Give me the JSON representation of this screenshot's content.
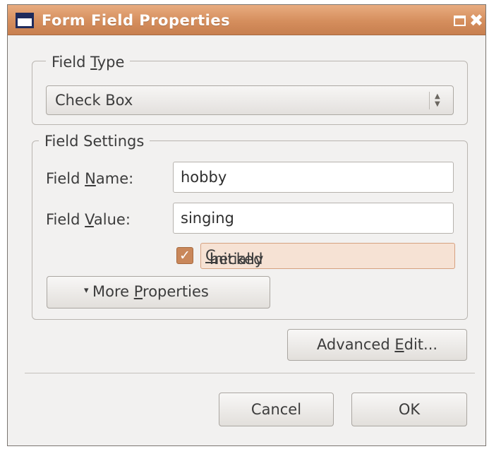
{
  "window": {
    "title": "Form Field Properties"
  },
  "field_type": {
    "group_label_pre": "Field ",
    "group_label_key": "T",
    "group_label_post": "ype",
    "selected": "Check Box"
  },
  "field_settings": {
    "group_label": "Field Settings",
    "name_label_pre": "Field ",
    "name_label_key": "N",
    "name_label_post": "ame:",
    "name_value": "hobby",
    "value_label_pre": "Field ",
    "value_label_key": "V",
    "value_label_post": "alue:",
    "value_value": "singing",
    "checkbox_checked": true,
    "checkbox_label_pre": "Initially ",
    "checkbox_label_key": "C",
    "checkbox_label_post": "hecked",
    "more_arrow": "▾",
    "more_label_pre": "More ",
    "more_label_key": "P",
    "more_label_post": "roperties"
  },
  "buttons": {
    "advanced_pre": "Advanced ",
    "advanced_key": "E",
    "advanced_post": "dit...",
    "cancel": "Cancel",
    "ok": "OK"
  },
  "colors": {
    "titlebar": "#d58e5d",
    "accent": "#c9875a",
    "checked_highlight": "#f6e2d4"
  },
  "icons": {
    "window_icon": "window-icon",
    "maximize": "maximize-icon",
    "close": "close-icon",
    "combo_arrows": "spinner-arrows-icon",
    "check": "checkmark-icon",
    "expander": "triangle-down-icon"
  }
}
